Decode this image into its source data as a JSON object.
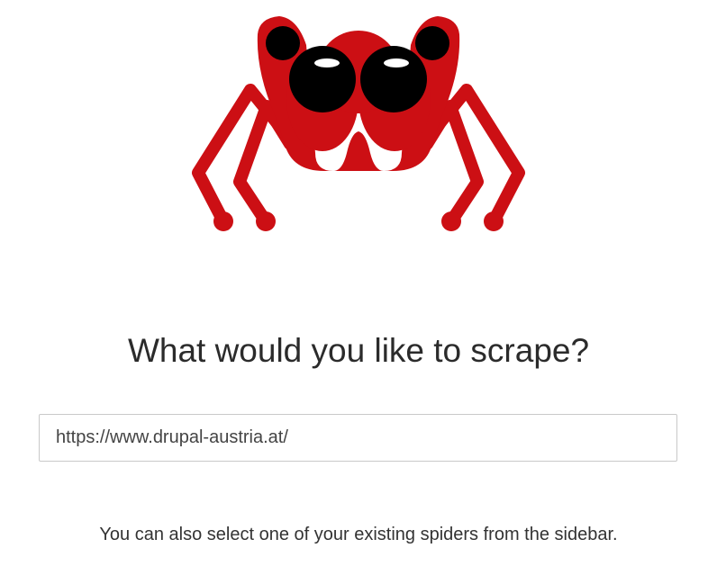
{
  "logo": {
    "name": "spider-logo",
    "colors": {
      "body": "#cc0f14",
      "eyes": "#000000",
      "highlight": "#ffffff"
    }
  },
  "main": {
    "headline": "What would you like to scrape?",
    "url_input": {
      "value": "https://www.drupal-austria.at/",
      "placeholder": ""
    },
    "hint": "You can also select one of your existing spiders from the sidebar."
  }
}
